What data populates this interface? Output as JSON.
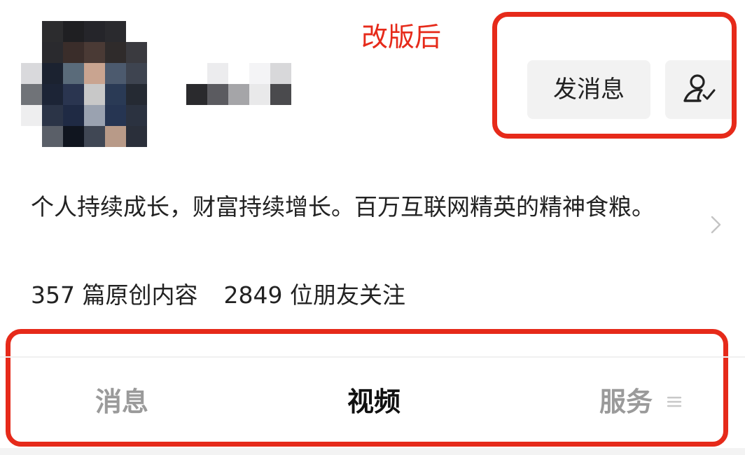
{
  "annotation": {
    "label": "改版后"
  },
  "profile": {
    "bio": "个人持续成长，财富持续增长。百万互联网精英的精神食粮。",
    "stats": {
      "articles_count": "357",
      "articles_label": "篇原创内容",
      "followers_count": "2849",
      "followers_label": "位朋友关注"
    }
  },
  "actions": {
    "send_message_label": "发消息",
    "follow_icon": "person-check-icon"
  },
  "tabs": [
    {
      "label": "消息",
      "active": false
    },
    {
      "label": "视频",
      "active": true
    },
    {
      "label": "服务",
      "active": false
    }
  ],
  "colors": {
    "annotation_red": "#e62a1a",
    "button_bg": "#f2f2f2",
    "tab_inactive": "#9a9a9a",
    "tab_active": "#111111"
  }
}
